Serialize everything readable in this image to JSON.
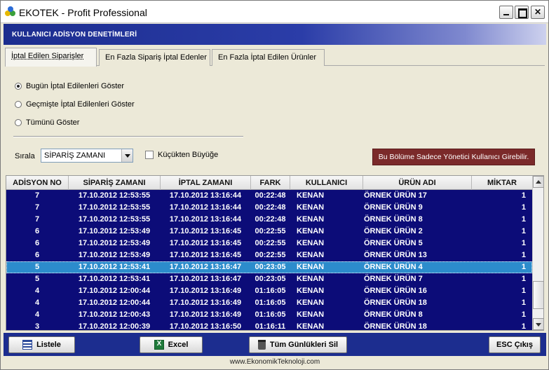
{
  "window": {
    "title": "EKOTEK - Profit Professional"
  },
  "header": {
    "title": "KULLANICI ADİSYON DENETİMLERİ"
  },
  "tabs": [
    {
      "label": "İptal Edilen Siparişler",
      "active": true
    },
    {
      "label": "En Fazla Sipariş İptal Edenler",
      "active": false
    },
    {
      "label": "En Fazla İptal Edilen Ürünler",
      "active": false
    }
  ],
  "filters": {
    "options": [
      {
        "label": "Bugün İptal Edilenleri Göster",
        "selected": true
      },
      {
        "label": "Geçmişte İptal Edilenleri Göster",
        "selected": false
      },
      {
        "label": "Tümünü Göster",
        "selected": false
      }
    ],
    "sort_label": "Sırala",
    "sort_value": "SİPARİŞ ZAMANI",
    "ascending_label": "Küçükten Büyüğe",
    "ascending_checked": false,
    "admin_notice": "Bu Bölüme Sadece Yönetici Kullanıcı Girebilir."
  },
  "table": {
    "columns": [
      "ADİSYON NO",
      "SİPARİŞ ZAMANI",
      "İPTAL ZAMANI",
      "FARK",
      "KULLANICI",
      "ÜRÜN ADI",
      "MİKTAR"
    ],
    "selected_row_index": 6,
    "rows": [
      [
        "7",
        "17.10.2012 12:53:55",
        "17.10.2012 13:16:44",
        "00:22:48",
        "KENAN",
        "ÖRNEK ÜRÜN 17",
        "1"
      ],
      [
        "7",
        "17.10.2012 12:53:55",
        "17.10.2012 13:16:44",
        "00:22:48",
        "KENAN",
        "ÖRNEK ÜRÜN 9",
        "1"
      ],
      [
        "7",
        "17.10.2012 12:53:55",
        "17.10.2012 13:16:44",
        "00:22:48",
        "KENAN",
        "ÖRNEK ÜRÜN 8",
        "1"
      ],
      [
        "6",
        "17.10.2012 12:53:49",
        "17.10.2012 13:16:45",
        "00:22:55",
        "KENAN",
        "ÖRNEK ÜRÜN 2",
        "1"
      ],
      [
        "6",
        "17.10.2012 12:53:49",
        "17.10.2012 13:16:45",
        "00:22:55",
        "KENAN",
        "ÖRNEK ÜRÜN 5",
        "1"
      ],
      [
        "6",
        "17.10.2012 12:53:49",
        "17.10.2012 13:16:45",
        "00:22:55",
        "KENAN",
        "ÖRNEK ÜRÜN 13",
        "1"
      ],
      [
        "5",
        "17.10.2012 12:53:41",
        "17.10.2012 13:16:47",
        "00:23:05",
        "KENAN",
        "ÖRNEK ÜRÜN 4",
        "1"
      ],
      [
        "5",
        "17.10.2012 12:53:41",
        "17.10.2012 13:16:47",
        "00:23:05",
        "KENAN",
        "ÖRNEK ÜRÜN 7",
        "1"
      ],
      [
        "4",
        "17.10.2012 12:00:44",
        "17.10.2012 13:16:49",
        "01:16:05",
        "KENAN",
        "ÖRNEK ÜRÜN 16",
        "1"
      ],
      [
        "4",
        "17.10.2012 12:00:44",
        "17.10.2012 13:16:49",
        "01:16:05",
        "KENAN",
        "ÖRNEK ÜRÜN 18",
        "1"
      ],
      [
        "4",
        "17.10.2012 12:00:43",
        "17.10.2012 13:16:49",
        "01:16:05",
        "KENAN",
        "ÖRNEK ÜRÜN 8",
        "1"
      ],
      [
        "3",
        "17.10.2012 12:00:39",
        "17.10.2012 13:16:50",
        "01:16:11",
        "KENAN",
        "ÖRNEK ÜRÜN 18",
        "1"
      ]
    ]
  },
  "buttons": {
    "list": "Listele",
    "excel": "Excel",
    "delete_all": "Tüm Günlükleri Sil",
    "exit": "ESC Çıkış"
  },
  "footer": {
    "text": "www.EkonomikTeknoloji.com"
  },
  "colors": {
    "header_band": "#1c2d8f",
    "grid_row": "#0c0c78",
    "grid_selected": "#2c8ccc",
    "admin_notice": "#7b2a2a"
  }
}
